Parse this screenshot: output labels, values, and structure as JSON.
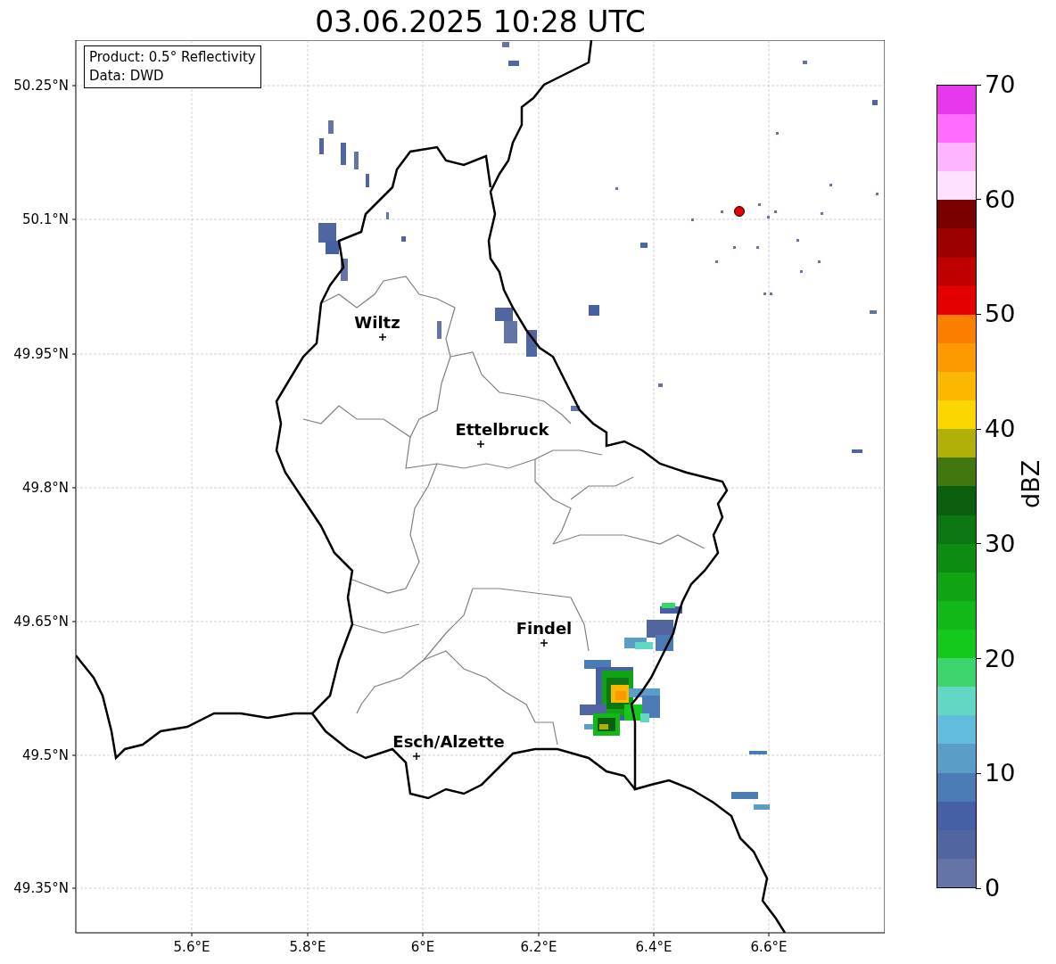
{
  "title": "03.06.2025 10:28 UTC",
  "info_box": [
    "Product: 0.5° Reflectivity",
    "Data: DWD"
  ],
  "x_ticks": [
    {
      "label": "5.6°E"
    },
    {
      "label": "5.8°E"
    },
    {
      "label": "6°E"
    },
    {
      "label": "6.2°E"
    },
    {
      "label": "6.4°E"
    },
    {
      "label": "6.6°E"
    }
  ],
  "y_ticks": [
    {
      "label": "50.25°N"
    },
    {
      "label": "50.1°N"
    },
    {
      "label": "49.95°N"
    },
    {
      "label": "49.8°N"
    },
    {
      "label": "49.65°N"
    },
    {
      "label": "49.5°N"
    },
    {
      "label": "49.35°N"
    }
  ],
  "cities": [
    {
      "name": "Wiltz"
    },
    {
      "name": "Ettelbruck"
    },
    {
      "name": "Findel"
    },
    {
      "name": "Esch/Alzette"
    }
  ],
  "colorbar": {
    "label": "dBZ",
    "ticks": [
      "70",
      "60",
      "50",
      "40",
      "30",
      "20",
      "10",
      "0"
    ],
    "bins": [
      {
        "color": "#6574a6"
      },
      {
        "color": "#5166a0"
      },
      {
        "color": "#4560a4"
      },
      {
        "color": "#4a7bb4"
      },
      {
        "color": "#5a9ec8"
      },
      {
        "color": "#62bcdc"
      },
      {
        "color": "#62d8c4"
      },
      {
        "color": "#3cd46c"
      },
      {
        "color": "#14c81c"
      },
      {
        "color": "#12b818"
      },
      {
        "color": "#10a414"
      },
      {
        "color": "#0e8c12"
      },
      {
        "color": "#0c7612"
      },
      {
        "color": "#0a5e0e"
      },
      {
        "color": "#42760e"
      },
      {
        "color": "#b0b008"
      },
      {
        "color": "#fcd600"
      },
      {
        "color": "#fcb800"
      },
      {
        "color": "#fc9800"
      },
      {
        "color": "#fc7e00"
      },
      {
        "color": "#e40000"
      },
      {
        "color": "#c00000"
      },
      {
        "color": "#9c0000"
      },
      {
        "color": "#780000"
      },
      {
        "color": "#ffe0ff"
      },
      {
        "color": "#ffb4ff"
      },
      {
        "color": "#ff6cff"
      },
      {
        "color": "#e838ec"
      }
    ]
  }
}
